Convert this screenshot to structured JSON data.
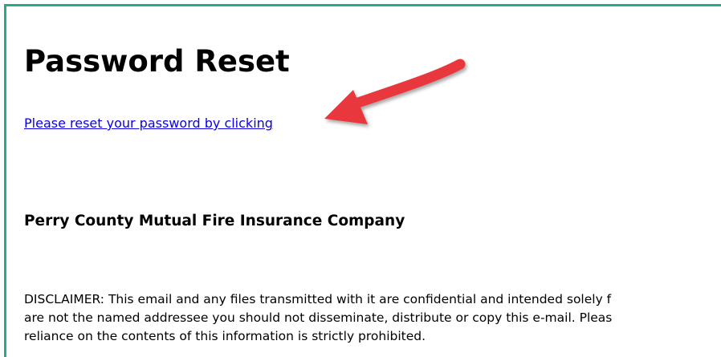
{
  "email": {
    "title": "Password Reset",
    "reset_link_text": "Please reset your password by clicking",
    "company_name": "Perry County Mutual Fire Insurance Company",
    "disclaimer_lines": [
      "DISCLAIMER: This email and any files transmitted with it are confidential and intended solely f",
      "are not the named addressee you should not disseminate, distribute or copy this e-mail. Pleas",
      "reliance on the contents of this information is strictly prohibited."
    ]
  },
  "annotation": {
    "arrow_color": "#e8383d",
    "frame_color": "#2aa88a",
    "link_color": "#0b00e8"
  }
}
